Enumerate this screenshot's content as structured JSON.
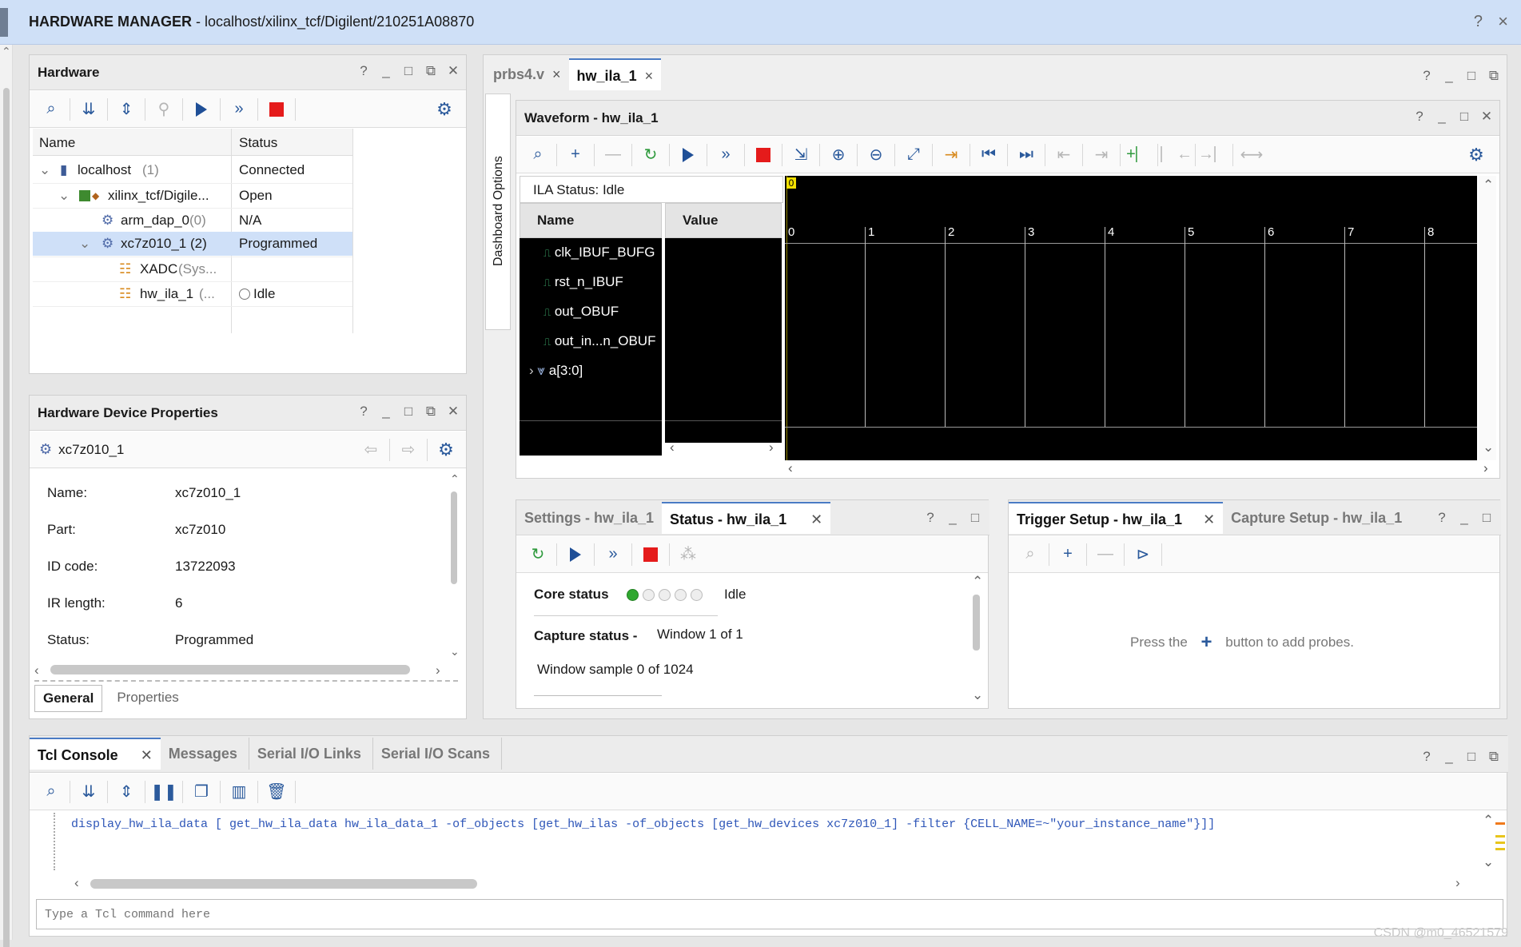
{
  "app": {
    "title_bold": "HARDWARE MANAGER",
    "title_path": "- localhost/xilinx_tcf/Digilent/210251A08870",
    "help_label": "?",
    "close_label": "×"
  },
  "hardware_panel": {
    "title": "Hardware",
    "columns": [
      "Name",
      "Status"
    ],
    "rows": [
      {
        "name": "localhost",
        "count": "(1)",
        "status": "Connected"
      },
      {
        "name": "xilinx_tcf/Digile...",
        "count": "",
        "status": "Open"
      },
      {
        "name": "arm_dap_0",
        "count": "(0)",
        "status": "N/A"
      },
      {
        "name": "xc7z010_1 (2)",
        "count": "",
        "status": "Programmed"
      },
      {
        "name": "XADC",
        "count": "(Sys...",
        "status": ""
      },
      {
        "name": "hw_ila_1",
        "count": "(...",
        "status": "Idle"
      }
    ]
  },
  "device_props": {
    "title": "Hardware Device Properties",
    "device": "xc7z010_1",
    "fields": [
      {
        "label": "Name:",
        "value": "xc7z010_1"
      },
      {
        "label": "Part:",
        "value": "xc7z010"
      },
      {
        "label": "ID code:",
        "value": "13722093"
      },
      {
        "label": "IR length:",
        "value": "6"
      },
      {
        "label": "Status:",
        "value": "Programmed"
      }
    ],
    "tabs": [
      "General",
      "Properties"
    ]
  },
  "editor_tabs": [
    {
      "label": "prbs4.v",
      "close": "×"
    },
    {
      "label": "hw_ila_1",
      "close": "×"
    }
  ],
  "dashboard_label": "Dashboard Options",
  "waveform": {
    "title": "Waveform - hw_ila_1",
    "ila_status": "ILA Status:  Idle",
    "name_header": "Name",
    "value_header": "Value",
    "probes": [
      "clk_IBUF_BUFG",
      "rst_n_IBUF",
      "out_OBUF",
      "out_in...n_OBUF",
      "a[3:0]"
    ],
    "marker": "0",
    "ticks": [
      "0",
      "1",
      "2",
      "3",
      "4",
      "5",
      "6",
      "7",
      "8"
    ]
  },
  "settings_status": {
    "tabs": [
      "Settings - hw_ila_1",
      "Status - hw_ila_1"
    ],
    "core_status_label": "Core status",
    "core_status_value": "Idle",
    "capture_status_label": "Capture status -",
    "capture_status_value": "Window 1 of 1",
    "window_sample": "Window sample 0 of 1024"
  },
  "trigger": {
    "tabs": [
      "Trigger Setup - hw_ila_1",
      "Capture Setup - hw_ila_1"
    ],
    "hint_prefix": "Press the",
    "hint_suffix": "button to add probes."
  },
  "console": {
    "tabs": [
      "Tcl Console",
      "Messages",
      "Serial I/O Links",
      "Serial I/O Scans"
    ],
    "command": "display_hw_ila_data [ get_hw_ila_data hw_ila_data_1 -of_objects [get_hw_ilas -of_objects [get_hw_devices xc7z010_1] -filter {CELL_NAME=~\"your_instance_name\"}]]",
    "placeholder": "Type a Tcl command here"
  },
  "watermark": "CSDN @m0_46521579",
  "colors": {
    "accent": "#4a7bc4",
    "stop": "#e51b1b",
    "status_on": "#2fa82f",
    "title_bar": "#cfe0f7"
  }
}
